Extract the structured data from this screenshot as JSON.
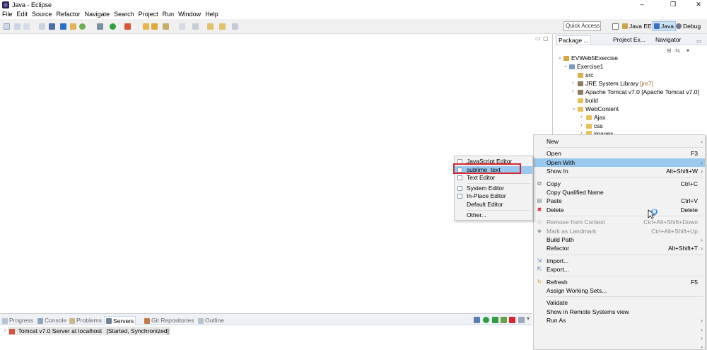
{
  "window": {
    "title": "Java - Eclipse",
    "controls": [
      "–",
      "❐",
      "✕"
    ]
  },
  "menubar": [
    "File",
    "Edit",
    "Source",
    "Refactor",
    "Navigate",
    "Search",
    "Project",
    "Run",
    "Window",
    "Help"
  ],
  "toolbar": {
    "quick_access_placeholder": "Quick Access",
    "perspectives": [
      {
        "label": "Java EE",
        "active": false
      },
      {
        "label": "Java",
        "active": true
      },
      {
        "label": "Debug",
        "active": false
      }
    ]
  },
  "explorer": {
    "tabs": [
      "Package ...",
      "Project Ex...",
      "Navigator"
    ],
    "tree": [
      {
        "label": "EVWeb5Exercise",
        "depth": 0,
        "expanded": true,
        "icon": "project-icon",
        "deco": ""
      },
      {
        "label": "Exercise1",
        "depth": 1,
        "expanded": true,
        "icon": "web-project-icon",
        "deco": ""
      },
      {
        "label": "src",
        "depth": 2,
        "expanded": null,
        "icon": "source-folder-icon",
        "deco": ""
      },
      {
        "label": "JRE System Library",
        "depth": 2,
        "expanded": false,
        "icon": "library-icon",
        "deco": "[jre7]"
      },
      {
        "label": "Apache Tomcat v7.0 [Apache Tomcat v7.0]",
        "depth": 2,
        "expanded": false,
        "icon": "library-icon",
        "deco": ""
      },
      {
        "label": "build",
        "depth": 2,
        "expanded": null,
        "icon": "folder-icon",
        "deco": ""
      },
      {
        "label": "WebContent",
        "depth": 2,
        "expanded": true,
        "icon": "folder-icon",
        "deco": ""
      },
      {
        "label": "Ajax",
        "depth": 3,
        "expanded": false,
        "icon": "folder-icon",
        "deco": ""
      },
      {
        "label": "css",
        "depth": 3,
        "expanded": false,
        "icon": "folder-icon",
        "deco": ""
      },
      {
        "label": "images",
        "depth": 3,
        "expanded": false,
        "icon": "folder-icon",
        "deco": ""
      }
    ]
  },
  "bottom_panel": {
    "tabs": [
      {
        "label": "Progress",
        "active": false
      },
      {
        "label": "Console",
        "active": false
      },
      {
        "label": "Problems",
        "active": false
      },
      {
        "label": "Servers",
        "active": true
      },
      {
        "label": "Git Repositories",
        "active": false
      },
      {
        "label": "Outline",
        "active": false
      }
    ],
    "server": {
      "name": "Tomcat v7.0 Server at localhost",
      "status": "[Started, Synchronized]"
    }
  },
  "context_menu": [
    {
      "label": "New",
      "shortcut": "",
      "submenu": true,
      "disabled": false,
      "highlight": false,
      "icon": ""
    },
    {
      "sep": true
    },
    {
      "label": "Open",
      "shortcut": "F3",
      "submenu": false,
      "disabled": false,
      "highlight": false,
      "icon": ""
    },
    {
      "label": "Open With",
      "shortcut": "",
      "submenu": true,
      "disabled": false,
      "highlight": true,
      "icon": ""
    },
    {
      "label": "Show In",
      "shortcut": "Alt+Shift+W",
      "submenu": true,
      "disabled": false,
      "highlight": false,
      "icon": ""
    },
    {
      "sep": true
    },
    {
      "label": "Copy",
      "shortcut": "Ctrl+C",
      "submenu": false,
      "disabled": false,
      "highlight": false,
      "icon": "copy-icon"
    },
    {
      "label": "Copy Qualified Name",
      "shortcut": "",
      "submenu": false,
      "disabled": false,
      "highlight": false,
      "icon": ""
    },
    {
      "label": "Paste",
      "shortcut": "Ctrl+V",
      "submenu": false,
      "disabled": false,
      "highlight": false,
      "icon": "paste-icon"
    },
    {
      "label": "Delete",
      "shortcut": "Delete",
      "submenu": false,
      "disabled": false,
      "highlight": false,
      "icon": "delete-icon"
    },
    {
      "sep": true
    },
    {
      "label": "Remove from Context",
      "shortcut": "Ctrl+Alt+Shift+Down",
      "submenu": false,
      "disabled": true,
      "highlight": false,
      "icon": "remove-context-icon"
    },
    {
      "label": "Mark as Landmark",
      "shortcut": "Ctrl+Alt+Shift+Up",
      "submenu": false,
      "disabled": true,
      "highlight": false,
      "icon": "landmark-icon"
    },
    {
      "label": "Build Path",
      "shortcut": "",
      "submenu": true,
      "disabled": false,
      "highlight": false,
      "icon": ""
    },
    {
      "label": "Refactor",
      "shortcut": "Alt+Shift+T",
      "submenu": true,
      "disabled": false,
      "highlight": false,
      "icon": ""
    },
    {
      "sep": true
    },
    {
      "label": "Import...",
      "shortcut": "",
      "submenu": false,
      "disabled": false,
      "highlight": false,
      "icon": "import-icon"
    },
    {
      "label": "Export...",
      "shortcut": "",
      "submenu": false,
      "disabled": false,
      "highlight": false,
      "icon": "export-icon"
    },
    {
      "sep": true
    },
    {
      "label": "Refresh",
      "shortcut": "F5",
      "submenu": false,
      "disabled": false,
      "highlight": false,
      "icon": "refresh-icon"
    },
    {
      "label": "Assign Working Sets...",
      "shortcut": "",
      "submenu": false,
      "disabled": false,
      "highlight": false,
      "icon": ""
    },
    {
      "sep": true
    },
    {
      "label": "Validate",
      "shortcut": "",
      "submenu": false,
      "disabled": false,
      "highlight": false,
      "icon": ""
    },
    {
      "label": "Show in Remote Systems view",
      "shortcut": "",
      "submenu": false,
      "disabled": false,
      "highlight": false,
      "icon": ""
    },
    {
      "label": "Run As",
      "shortcut": "",
      "submenu": true,
      "disabled": false,
      "highlight": false,
      "icon": ""
    },
    {
      "label": "",
      "shortcut": "",
      "submenu": true,
      "disabled": false,
      "highlight": false,
      "icon": ""
    },
    {
      "label": "",
      "shortcut": "",
      "submenu": true,
      "disabled": false,
      "highlight": false,
      "icon": ""
    },
    {
      "label": "",
      "shortcut": "",
      "submenu": true,
      "disabled": false,
      "highlight": false,
      "icon": ""
    },
    {
      "label": "",
      "shortcut": "",
      "submenu": true,
      "disabled": false,
      "highlight": false,
      "icon": ""
    }
  ],
  "open_with_submenu": [
    {
      "label": "JavaScript Editor",
      "icon": true,
      "highlight": false
    },
    {
      "label": "sublime_text",
      "icon": true,
      "highlight": true
    },
    {
      "label": "Text Editor",
      "icon": true,
      "highlight": false
    },
    {
      "sep": true
    },
    {
      "label": "System Editor",
      "icon": true,
      "highlight": false
    },
    {
      "label": "In-Place Editor",
      "icon": true,
      "highlight": false
    },
    {
      "label": "Default Editor",
      "icon": false,
      "highlight": false
    },
    {
      "sep": true
    },
    {
      "label": "Other...",
      "icon": false,
      "highlight": false
    }
  ],
  "colors": {
    "highlight": "#99c9ef",
    "annotation_box": "#d7262e",
    "menu_bg": "#f2f2f2"
  }
}
